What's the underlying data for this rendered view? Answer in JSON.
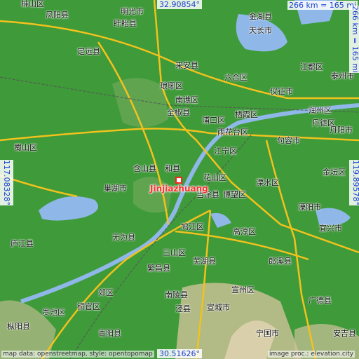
{
  "target": {
    "name": "Jinjiazhuang",
    "color": "#ff3030"
  },
  "coordinates": {
    "top_lat": "32.90854°",
    "bottom_lat": "30.51626°",
    "left_lon": "117.08328°",
    "right_lon": "119.89578°"
  },
  "scale": {
    "horizontal": "266 km = 165 mi",
    "vertical": "266 km = 165 mi"
  },
  "credits": {
    "left": "map data: openstreetmap, style: opentopomap",
    "right": "image proc.: elevation.city"
  },
  "colors": {
    "lowland": "#3f9a3a",
    "hill": "#cfc29a",
    "water": "#8fb7e8",
    "road": "#f2c21d",
    "rail": "#555555",
    "coord_text": "#1a3fd0"
  },
  "places": [
    {
      "id": "benghuashi",
      "text": "蚌山区"
    },
    {
      "id": "fengyang",
      "text": "凤阳县"
    },
    {
      "id": "mingguang",
      "text": "明光市"
    },
    {
      "id": "xuyi",
      "text": "盱眙县"
    },
    {
      "id": "jinhu",
      "text": "金湖县"
    },
    {
      "id": "dingyuan",
      "text": "定远县"
    },
    {
      "id": "chuzhou_tianchang",
      "text": "天长市"
    },
    {
      "id": "laian",
      "text": "来安县"
    },
    {
      "id": "langya",
      "text": "琅琊区"
    },
    {
      "id": "nanqiao",
      "text": "南谯区"
    },
    {
      "id": "quanjiao",
      "text": "全椒县"
    },
    {
      "id": "liuhe",
      "text": "六合区"
    },
    {
      "id": "pukou",
      "text": "浦口区"
    },
    {
      "id": "qixia",
      "text": "栖霞区"
    },
    {
      "id": "yizheng",
      "text": "仪征市"
    },
    {
      "id": "jiangdu",
      "text": "江都区"
    },
    {
      "id": "taizhou",
      "text": "泰州市"
    },
    {
      "id": "runzhou",
      "text": "润州区"
    },
    {
      "id": "dantu",
      "text": "丹徒区"
    },
    {
      "id": "danyang",
      "text": "丹阳市"
    },
    {
      "id": "jurong",
      "text": "句容市"
    },
    {
      "id": "jiangning",
      "text": "江宁区"
    },
    {
      "id": "jintan",
      "text": "金坛区"
    },
    {
      "id": "lishui",
      "text": "溧水区"
    },
    {
      "id": "yuhua",
      "text": "雨花台区"
    },
    {
      "id": "hanshan",
      "text": "含山县"
    },
    {
      "id": "hexian",
      "text": "和县"
    },
    {
      "id": "huashan",
      "text": "花山区"
    },
    {
      "id": "dangtu",
      "text": "当涂县"
    },
    {
      "id": "bowang",
      "text": "博望区"
    },
    {
      "id": "chaohu",
      "text": "巢湖市"
    },
    {
      "id": "shushan",
      "text": "蜀山区"
    },
    {
      "id": "lujiang",
      "text": "庐江县"
    },
    {
      "id": "wuwei",
      "text": "无为县"
    },
    {
      "id": "sanshan",
      "text": "三山区"
    },
    {
      "id": "jiujiang",
      "text": "鸠江区"
    },
    {
      "id": "wuhu",
      "text": "芜湖县"
    },
    {
      "id": "gaochun",
      "text": "高淳区"
    },
    {
      "id": "langxi",
      "text": "郎溪县"
    },
    {
      "id": "fanchang",
      "text": "繁昌县"
    },
    {
      "id": "nanling",
      "text": "南陵县"
    },
    {
      "id": "xuanzhou",
      "text": "宣州区"
    },
    {
      "id": "guangde",
      "text": "广德县"
    },
    {
      "id": "xuancheng",
      "text": "宣城市"
    },
    {
      "id": "tongling",
      "text": "铜官区"
    },
    {
      "id": "jiaoqu",
      "text": "郊区"
    },
    {
      "id": "qingyang",
      "text": "青阳县"
    },
    {
      "id": "jingxian",
      "text": "泾县"
    },
    {
      "id": "ningguo",
      "text": "宁国市"
    },
    {
      "id": "anji",
      "text": "安吉县"
    },
    {
      "id": "yixing",
      "text": "宜兴市"
    },
    {
      "id": "liyang",
      "text": "溧阳市"
    },
    {
      "id": "zongyang",
      "text": "枞阳县"
    },
    {
      "id": "chizhou",
      "text": "贵池区"
    }
  ]
}
